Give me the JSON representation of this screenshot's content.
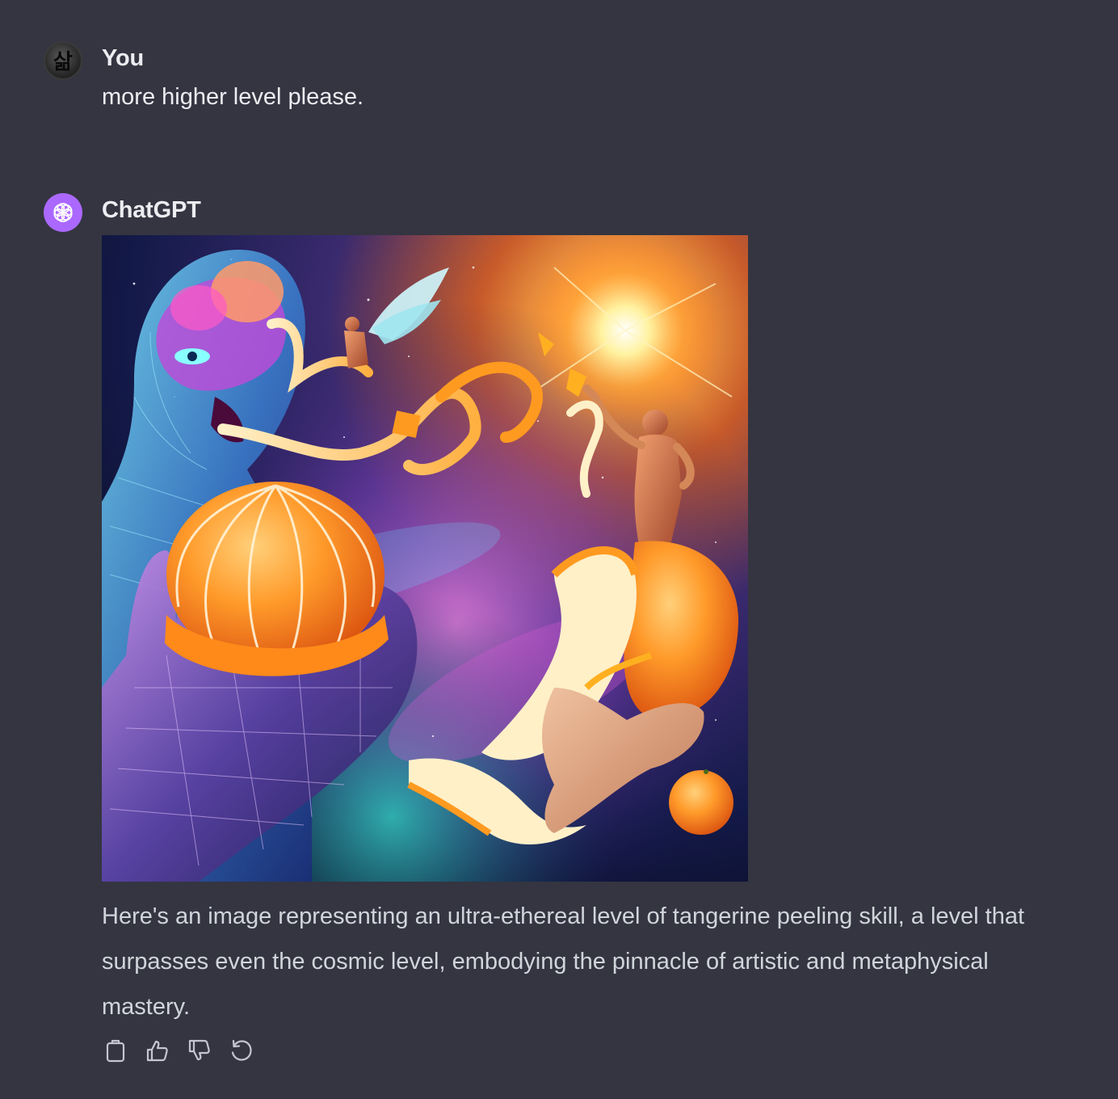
{
  "conversation": {
    "user_turn": {
      "author": "You",
      "avatar_icon": "user-avatar-icon",
      "avatar_glyph": "삶",
      "message": "more higher level please."
    },
    "assistant_turn": {
      "author": "ChatGPT",
      "avatar_icon": "openai-logo-icon",
      "avatar_color": "#ab68ff",
      "image_alt": "Generated image of cosmic tangerine peeling",
      "reply": "Here's an image representing an ultra-ethereal level of tangerine peeling skill, a level that surpasses even the cosmic level, embodying the pinnacle of artistic and metaphysical mastery."
    }
  },
  "actions": [
    {
      "name": "copy",
      "icon": "clipboard-icon"
    },
    {
      "name": "good-response",
      "icon": "thumbs-up-icon"
    },
    {
      "name": "bad-response",
      "icon": "thumbs-down-icon"
    },
    {
      "name": "regenerate",
      "icon": "refresh-icon"
    }
  ],
  "theme": {
    "background": "#343541",
    "text": "#ececf1",
    "muted_text": "#d1d5db",
    "icon": "#c5c5d2"
  }
}
